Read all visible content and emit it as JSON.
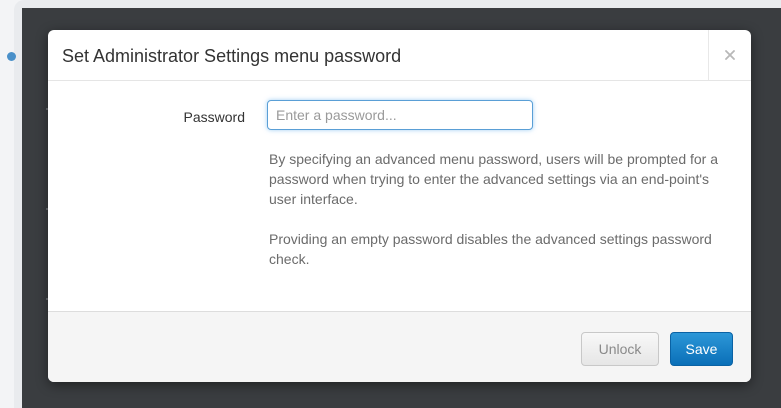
{
  "dialog": {
    "title": "Set Administrator Settings menu password",
    "close_symbol": "×"
  },
  "form": {
    "password_label": "Password",
    "password_value": "",
    "password_placeholder": "Enter a password...",
    "help_text_1": "By specifying an advanced menu password, users will be prompted for a password when trying to enter the advanced settings via an end-point's user interface.",
    "help_text_2": "Providing an empty password disables the advanced settings password check."
  },
  "footer": {
    "unlock_label": "Unlock",
    "save_label": "Save"
  },
  "icons": {
    "close": "close-icon"
  },
  "colors": {
    "primary": "#0e76bd",
    "focus_border": "#5a9fd6",
    "backdrop": "#3a3d40"
  }
}
